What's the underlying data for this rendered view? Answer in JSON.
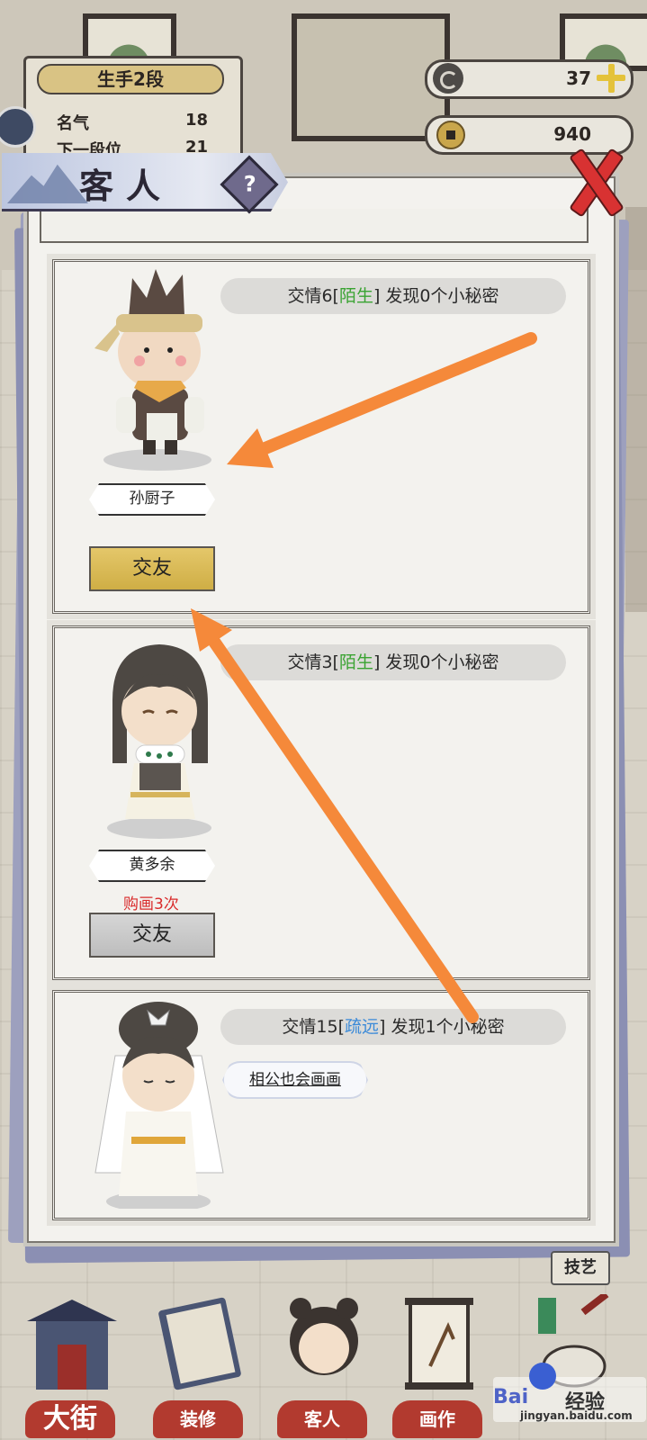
{
  "hud": {
    "rank_title": "生手2段",
    "fame_label": "名气",
    "fame_value": "18",
    "next_rank_label": "下一段位",
    "next_rank_value": "21",
    "resource_1_value": "37",
    "resource_2_value": "940",
    "icons": [
      "cloud-icon",
      "coin-icon",
      "plus-icon"
    ]
  },
  "modal": {
    "title": "客人",
    "help_label": "?",
    "close_icon": "close-x-icon"
  },
  "guests": [
    {
      "info_prefix": "交情6[",
      "relation": "陌生",
      "info_suffix": "] 发现0个小秘密",
      "relation_color": "#3aa332",
      "name": "孙厨子",
      "button_label": "交友",
      "button_state": "gold"
    },
    {
      "info_prefix": "交情3[",
      "relation": "陌生",
      "info_suffix": "] 发现0个小秘密",
      "relation_color": "#3aa332",
      "name": "黄多余",
      "purchase_note": "购画3次",
      "button_label": "交友",
      "button_state": "gray"
    },
    {
      "info_prefix": "交情15[",
      "relation": "疏远",
      "info_suffix": "] 发现1个小秘密",
      "relation_color": "#3b8ad8",
      "secret": "相公也会画画"
    }
  ],
  "nav": {
    "skill_badge": "技艺",
    "items": [
      "大街",
      "装修",
      "客人",
      "画作"
    ]
  },
  "watermark": {
    "brand": "Bai",
    "brand2": "经验",
    "url": "jingyan.baidu.com"
  },
  "colors": {
    "annotation_arrow": "#f5893a",
    "button_gold": "#d8b955",
    "button_gray": "#c8c8c8",
    "nav_red": "#b23a2f"
  }
}
